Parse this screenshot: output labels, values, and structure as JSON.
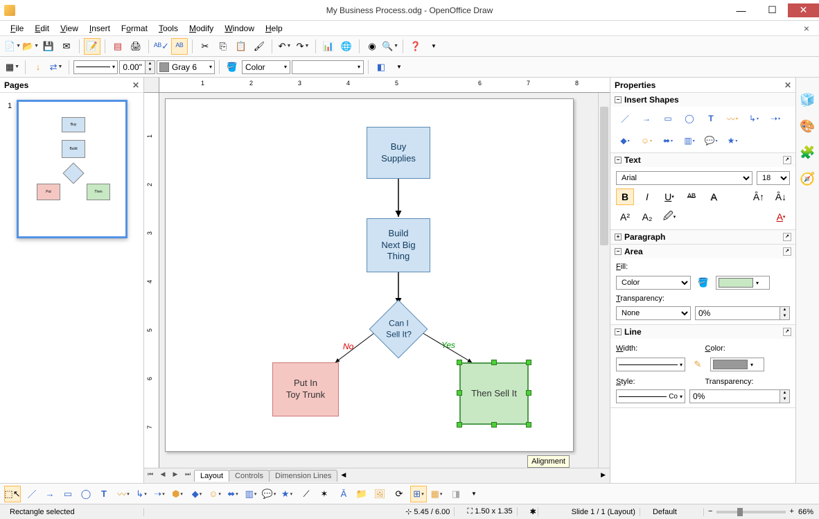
{
  "window": {
    "title": "My Business Process.odg - OpenOffice Draw"
  },
  "menu": [
    "File",
    "Edit",
    "View",
    "Insert",
    "Format",
    "Tools",
    "Modify",
    "Window",
    "Help"
  ],
  "toolbar2": {
    "linewidth": "0.00\"",
    "colorname": "Gray 6",
    "areastyle": "Color"
  },
  "panels": {
    "pages": "Pages",
    "properties": "Properties"
  },
  "flow": {
    "buy": "Buy\nSupplies",
    "build": "Build\nNext Big\nThing",
    "cani": "Can I\nSell It?",
    "put": "Put In\nToy Trunk",
    "then": "Then Sell It",
    "no": "No",
    "yes": "Yes"
  },
  "tabs": {
    "layout": "Layout",
    "controls": "Controls",
    "dimlines": "Dimension Lines",
    "tooltip": "Alignment"
  },
  "props": {
    "insertshapes": "Insert Shapes",
    "text": "Text",
    "font": "Arial",
    "fontsize": "18",
    "paragraph": "Paragraph",
    "area": "Area",
    "fill": "Fill:",
    "fill_mode": "Color",
    "transparency": "Transparency:",
    "trans_mode": "None",
    "trans_val": "0%",
    "line": "Line",
    "width": "Width:",
    "color": "Color:",
    "style": "Style:",
    "style_val": "Co",
    "line_trans": "0%"
  },
  "status": {
    "sel": "Rectangle selected",
    "pos": "5.45 / 6.00",
    "size": "1.50 x 1.35",
    "slide": "Slide 1 / 1 (Layout)",
    "style": "Default",
    "zoom": "66%"
  },
  "colors": {
    "gray6": "#999999",
    "lightgreen": "#c7e8c3"
  }
}
